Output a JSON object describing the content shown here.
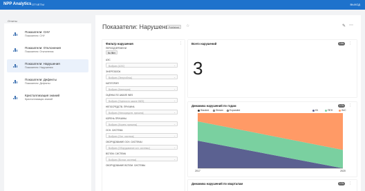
{
  "header": {
    "brand": "NPP Analytics",
    "nav_reports": "ОТЧЕТЫ",
    "logout": "ВЫХОД"
  },
  "sidebar": {
    "title": "Отчеты",
    "items": [
      {
        "name": "Показатели: СНУ",
        "sub": "Показатели: СНУ",
        "active": false
      },
      {
        "name": "Показатели: Отклонения",
        "sub": "Показатели: Отклонения",
        "active": false
      },
      {
        "name": "Показатели: Нарушения",
        "sub": "Показатели: Нарушения",
        "active": true
      },
      {
        "name": "Показатели: Дефекты",
        "sub": "Показатели: Дефекты",
        "active": false
      },
      {
        "name": "Кристаллизация знаний",
        "sub": "Кристаллизация знаний",
        "active": false
      }
    ]
  },
  "dashboard": {
    "title": "Показатели: Нарушения",
    "status_badge": "Published",
    "icons": {
      "favorite": "star-icon",
      "edit": "pencil-icon",
      "more": "more-icon"
    }
  },
  "filter_panel": {
    "title": "Фильтр нарушения",
    "period_label": "ПЕРИОД ВРЕМЕНИ",
    "period_value": "No filter",
    "fields": [
      {
        "label": "АЭС",
        "placeholder": "Выбрать [АЭС]"
      },
      {
        "label": "ЭНЕРГОБЛОК",
        "placeholder": "Выбрать [Энергоблок]"
      },
      {
        "label": "КАТЕГОРИЯ",
        "placeholder": "Выбрать [Категория]"
      },
      {
        "label": "ОЦЕНКА ПО ШКАЛЕ INES",
        "placeholder": "Выбрать [Оценка по шкале INES]"
      },
      {
        "label": "НЕПОСРЕДСТВ. ПРИЧИНА",
        "placeholder": "Выбрать [Непосредств. причина]"
      },
      {
        "label": "КОРЕНЬ ПРИЧИНЫ",
        "placeholder": "Выбрать [Корень причины]"
      },
      {
        "label": "ОСН. СИСТЕМА",
        "placeholder": "Выбрать [Осн. система]"
      },
      {
        "label": "ОБОРУДОВАНИЕ ОСН. СИСТЕМЫ",
        "placeholder": "Выбрать [Оборудование осн. системы]"
      },
      {
        "label": "ВСПОМ. СИСТЕМА",
        "placeholder": "Выбрать [Вспом. система]"
      },
      {
        "label": "ОБОРУДОВАНИЕ ВСПОМ. СИСТЕМЫ",
        "placeholder": ""
      }
    ]
  },
  "total_panel": {
    "title": "Всего нарушений",
    "badge": "1.4s",
    "value": "3"
  },
  "dynamics_panel": {
    "title": "Динамика нарушений по годам",
    "badge": "1.7s"
  },
  "quarters_panel": {
    "title": "Динамика нарушений по кварталам",
    "badge": "1.7s"
  },
  "chart_data": {
    "type": "area",
    "title": "Динамика нарушений по годам",
    "x": [
      "2017",
      "2020"
    ],
    "stack_mode": "Stacked",
    "modes": [
      "Stacked",
      "Stream",
      "Expanded"
    ],
    "series": [
      {
        "name": "КЧ",
        "values": [
          1.5,
          0
        ],
        "color": "#5b6191"
      },
      {
        "name": "ПЕН",
        "values": [
          1.05,
          1
        ],
        "color": "#7ad0a0"
      },
      {
        "name": "ЛеС",
        "values": [
          0.45,
          2
        ],
        "color": "#ff9a66"
      }
    ],
    "ylim": [
      0,
      3
    ],
    "legend_position": "top-right"
  }
}
